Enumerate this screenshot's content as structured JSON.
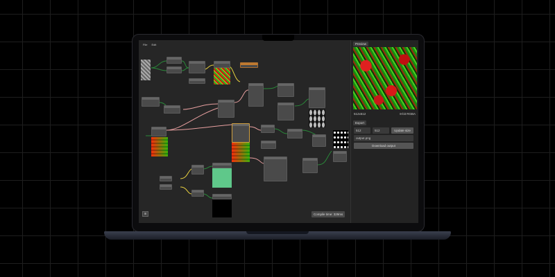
{
  "menu": {
    "file": "File",
    "edit": "Edit"
  },
  "panel": {
    "preview_tab": "Preview",
    "resolution": "512x512",
    "format": "8-bit RGBA",
    "export_tab": "Export",
    "width": "512",
    "height": "512",
    "update_size": "Update size",
    "filename": "output.png",
    "download": "Download output"
  },
  "status": {
    "compile_time": "Compile time: 329ms"
  },
  "colors": {
    "wire_green": "#2a8a3a",
    "wire_yellow": "#e8d040",
    "wire_pink": "#e8a0a0"
  }
}
